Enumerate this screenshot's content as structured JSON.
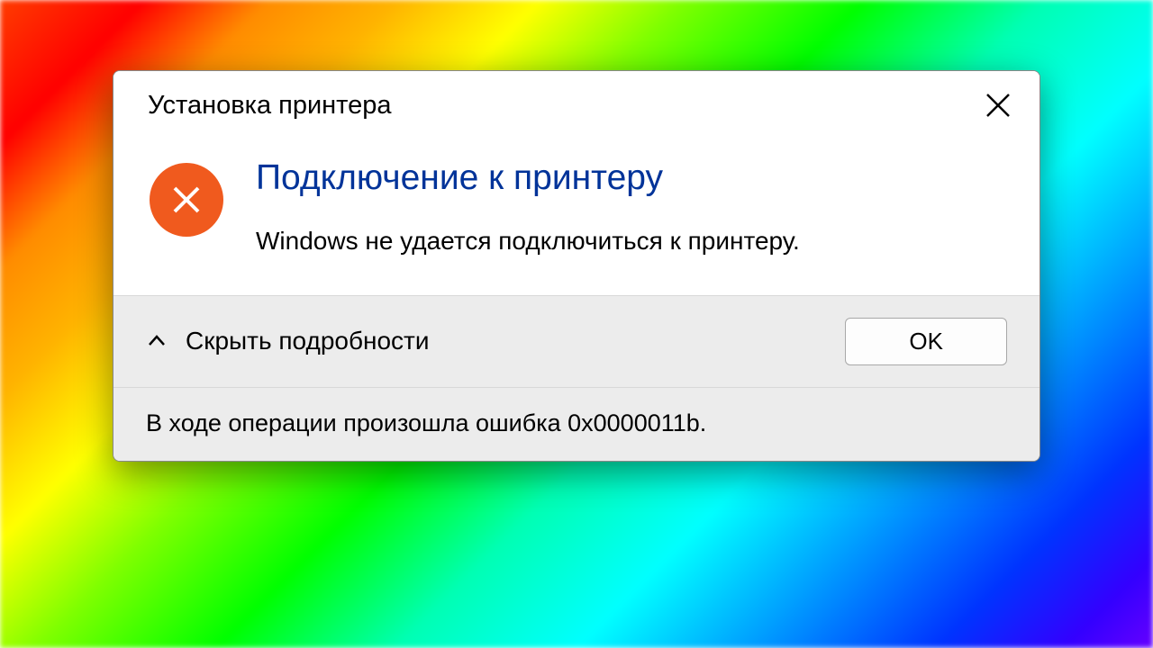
{
  "dialog": {
    "title": "Установка принтера",
    "heading": "Подключение к принтеру",
    "message": "Windows не удается подключиться к принтеру.",
    "details_toggle_label": "Скрыть подробности",
    "ok_label": "OK",
    "details_message": "В ходе операции произошла ошибка 0x0000011b."
  }
}
